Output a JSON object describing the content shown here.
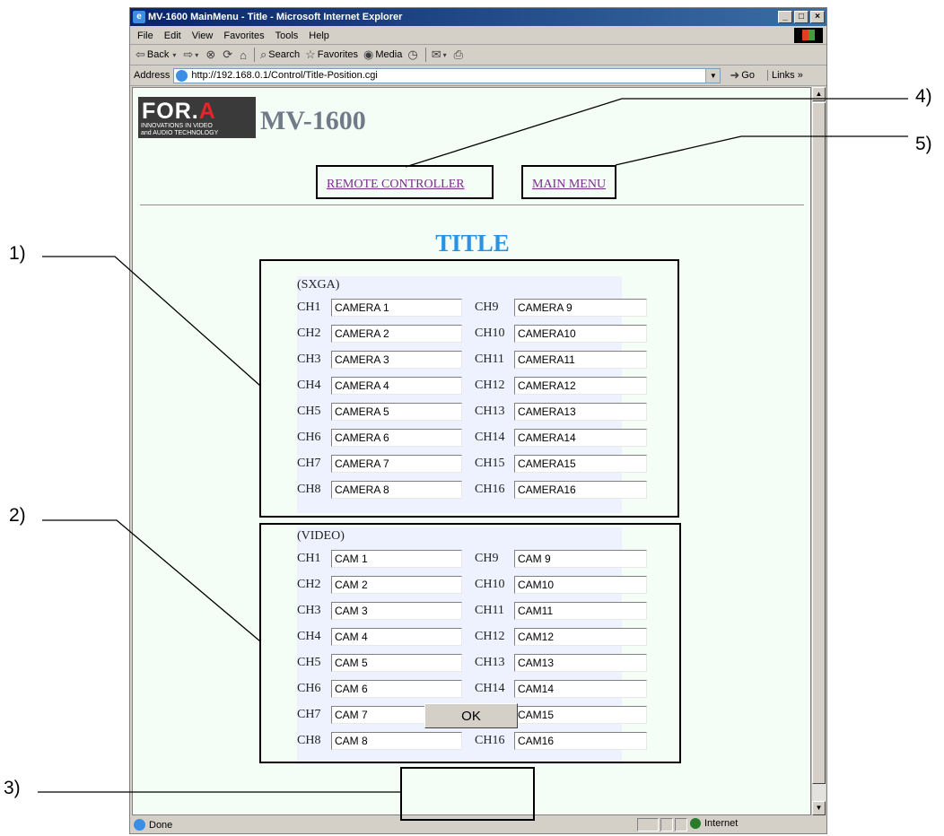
{
  "window": {
    "title": "MV-1600 MainMenu - Title - Microsoft Internet Explorer",
    "buttons": [
      "_",
      "□",
      "×"
    ]
  },
  "menu": [
    "File",
    "Edit",
    "View",
    "Favorites",
    "Tools",
    "Help"
  ],
  "toolbar": {
    "back": "Back",
    "search": "Search",
    "favorites": "Favorites",
    "media": "Media"
  },
  "address": {
    "label": "Address",
    "url": "http://192.168.0.1/Control/Title-Position.cgi",
    "go": "Go",
    "links": "Links"
  },
  "page": {
    "logo_text_a": "FOR.",
    "logo_text_b": "A",
    "logo_tagline_1": "INNOVATIONS IN VIDEO",
    "logo_tagline_2": "and AUDIO TECHNOLOGY",
    "product": "MV-1600",
    "nav_remote": "REMOTE CONTROLLER",
    "nav_main": "MAIN MENU",
    "title": "TITLE",
    "ok": "OK"
  },
  "sxga": {
    "label": "(SXGA)",
    "left": [
      {
        "ch": "CH1",
        "value": "CAMERA 1"
      },
      {
        "ch": "CH2",
        "value": "CAMERA 2"
      },
      {
        "ch": "CH3",
        "value": "CAMERA 3"
      },
      {
        "ch": "CH4",
        "value": "CAMERA 4"
      },
      {
        "ch": "CH5",
        "value": "CAMERA 5"
      },
      {
        "ch": "CH6",
        "value": "CAMERA 6"
      },
      {
        "ch": "CH7",
        "value": "CAMERA 7"
      },
      {
        "ch": "CH8",
        "value": "CAMERA 8"
      }
    ],
    "right": [
      {
        "ch": "CH9",
        "value": "CAMERA 9"
      },
      {
        "ch": "CH10",
        "value": "CAMERA10"
      },
      {
        "ch": "CH11",
        "value": "CAMERA11"
      },
      {
        "ch": "CH12",
        "value": "CAMERA12"
      },
      {
        "ch": "CH13",
        "value": "CAMERA13"
      },
      {
        "ch": "CH14",
        "value": "CAMERA14"
      },
      {
        "ch": "CH15",
        "value": "CAMERA15"
      },
      {
        "ch": "CH16",
        "value": "CAMERA16"
      }
    ]
  },
  "video": {
    "label": "(VIDEO)",
    "left": [
      {
        "ch": "CH1",
        "value": "CAM 1"
      },
      {
        "ch": "CH2",
        "value": "CAM 2"
      },
      {
        "ch": "CH3",
        "value": "CAM 3"
      },
      {
        "ch": "CH4",
        "value": "CAM 4"
      },
      {
        "ch": "CH5",
        "value": "CAM 5"
      },
      {
        "ch": "CH6",
        "value": "CAM 6"
      },
      {
        "ch": "CH7",
        "value": "CAM 7"
      },
      {
        "ch": "CH8",
        "value": "CAM 8"
      }
    ],
    "right": [
      {
        "ch": "CH9",
        "value": "CAM 9"
      },
      {
        "ch": "CH10",
        "value": "CAM10"
      },
      {
        "ch": "CH11",
        "value": "CAM11"
      },
      {
        "ch": "CH12",
        "value": "CAM12"
      },
      {
        "ch": "CH13",
        "value": "CAM13"
      },
      {
        "ch": "CH14",
        "value": "CAM14"
      },
      {
        "ch": "CH15",
        "value": "CAM15"
      },
      {
        "ch": "CH16",
        "value": "CAM16"
      }
    ]
  },
  "status": {
    "text": "Done",
    "zone": "Internet"
  },
  "callouts": {
    "c1": "1)",
    "c2": "2)",
    "c3": "3)",
    "c4": "4)",
    "c5": "5)"
  },
  "colors": {
    "title_blue": "#2a92e4",
    "link_purple": "#7b2b8e",
    "content_bg": "#f4fdf6",
    "panel_bg": "#eef2ff"
  }
}
